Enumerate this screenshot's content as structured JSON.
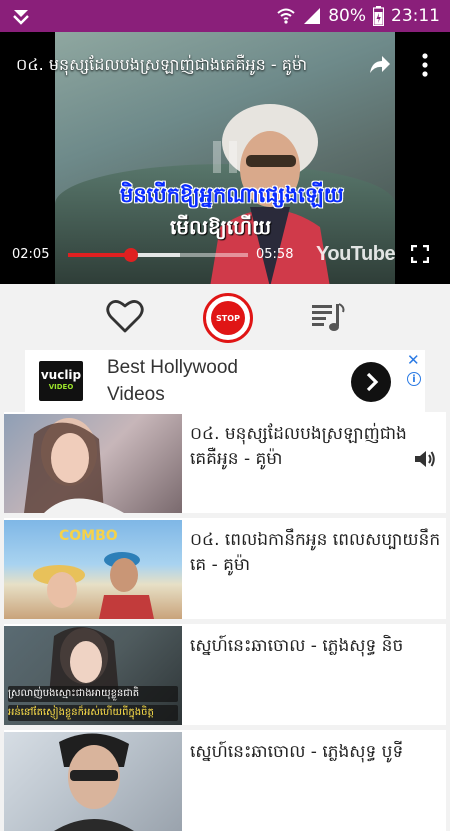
{
  "status_bar": {
    "battery_percent": "80%",
    "time": "23:11"
  },
  "player": {
    "title": "០៤. មនុស្សដែលបងស្រឡាញ់ជាងគេគឺអូន - គូម៉ា",
    "lyric_line1": "មិនបើកឱ្យអ្នកណាផ្សេងឡើយ",
    "lyric_line2": "មើលឱ្យហើយ",
    "current_time": "02:05",
    "total_time": "05:58",
    "progress_fraction": 0.35,
    "buffered_fraction": 0.62,
    "watermark": "YouTube"
  },
  "controls": {
    "stop_label": "STOP"
  },
  "ad": {
    "logo_text": "vuclip",
    "logo_sub": "VIDEO",
    "headline": "Best Hollywood Videos",
    "close_glyph": "✕",
    "info_glyph": "i"
  },
  "playlist": [
    {
      "title": "០៤. មនុស្សដែលបងស្រឡាញ់ជាងគេគឺអូន - គូម៉ា",
      "playing": true
    },
    {
      "title": "០៤. ពេលឯកានឹកអូន ពេលសប្បាយនឹកគេ - គូម៉ា",
      "playing": false
    },
    {
      "title": "ស្នេហ៍នេះឆាចោល - ភ្លេងសុទ្ធ និច",
      "playing": false
    },
    {
      "title": "ស្នេហ៍នេះឆាចោល - ភ្លេងសុទ្ធ បូទី",
      "playing": false
    }
  ],
  "thumb_caption_3": {
    "line1": "ស្រលាញ់បងស្មោះជាងអាយុខ្លួនជាតិ",
    "line2": "អន់នៅតែស្ញៀងខ្លួនក៏អស់ហើយពីក្នុងចិត្ត"
  },
  "colors": {
    "status_bar": "#8a1f7a",
    "accent_red": "#e01515",
    "seek_played": "#e02020"
  }
}
